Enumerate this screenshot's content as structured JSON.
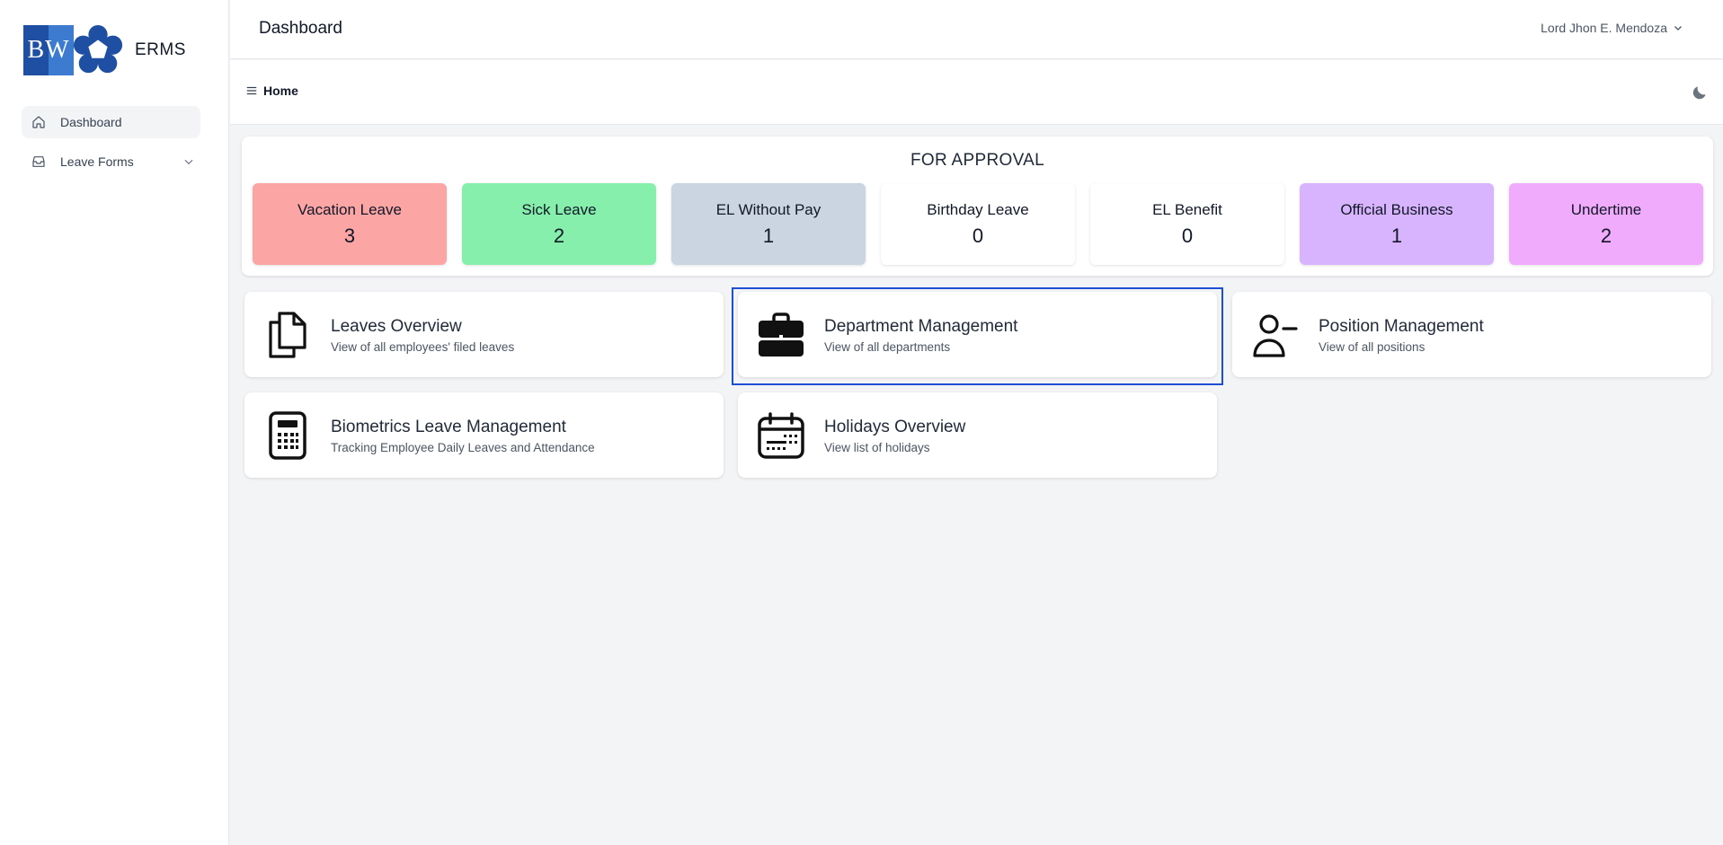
{
  "app": {
    "logo_text": "BW",
    "name": "ERMS"
  },
  "sidebar": {
    "items": [
      {
        "label": "Dashboard",
        "icon": "home-icon",
        "active": true
      },
      {
        "label": "Leave Forms",
        "icon": "inbox-icon",
        "has_submenu": true
      }
    ]
  },
  "header": {
    "title": "Dashboard",
    "user_name": "Lord Jhon E. Mendoza"
  },
  "subheader": {
    "breadcrumb": "Home"
  },
  "approval": {
    "title": "FOR APPROVAL",
    "cards": [
      {
        "label": "Vacation Leave",
        "count": "3",
        "color": "#fca5a5"
      },
      {
        "label": "Sick Leave",
        "count": "2",
        "color": "#86efac"
      },
      {
        "label": "EL Without Pay",
        "count": "1",
        "color": "#cbd5e1"
      },
      {
        "label": "Birthday Leave",
        "count": "0",
        "color": "#ffffff"
      },
      {
        "label": "EL Benefit",
        "count": "0",
        "color": "#ffffff"
      },
      {
        "label": "Official Business",
        "count": "1",
        "color": "#d8b4fe"
      },
      {
        "label": "Undertime",
        "count": "2",
        "color": "#f0abfc"
      }
    ]
  },
  "modules": [
    {
      "title": "Leaves Overview",
      "subtitle": "View of all employees' filed leaves",
      "icon": "documents-icon"
    },
    {
      "title": "Department Management",
      "subtitle": "View of all departments",
      "icon": "briefcase-icon"
    },
    {
      "title": "Position Management",
      "subtitle": "View of all positions",
      "icon": "user-minus-icon"
    },
    {
      "title": "Biometrics Leave Management",
      "subtitle": "Tracking Employee Daily Leaves and Attendance",
      "icon": "calculator-icon"
    },
    {
      "title": "Holidays Overview",
      "subtitle": "View list of holidays",
      "icon": "calendar-icon"
    }
  ],
  "colors": {
    "accent_focus": "#1d4ed8",
    "logo_blue": "#1e4fa3"
  }
}
